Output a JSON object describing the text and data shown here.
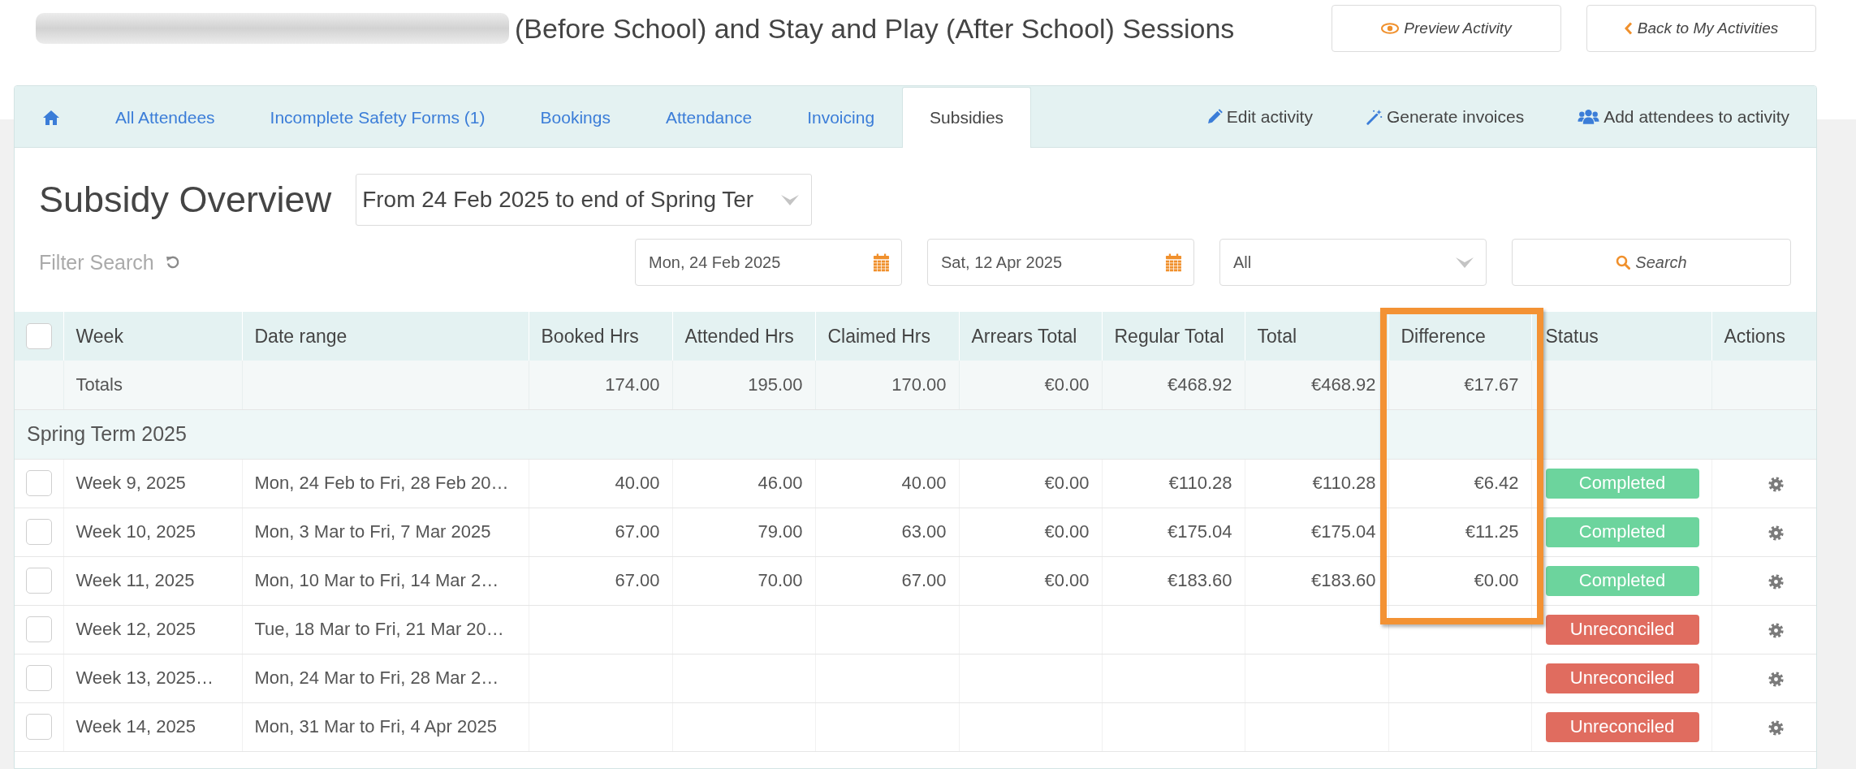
{
  "header": {
    "title_redacted": true,
    "title": "(Before School) and Stay and Play (After School) Sessions",
    "buttons": [
      {
        "kind": "preview",
        "label": "Preview Activity"
      },
      {
        "kind": "back",
        "label": "Back to My Activities"
      }
    ]
  },
  "tabs": [
    {
      "kind": "home",
      "selected": false
    },
    {
      "kind": "text",
      "label": "All Attendees",
      "selected": false
    },
    {
      "kind": "text",
      "label": "Incomplete Safety Forms (1)",
      "selected": false
    },
    {
      "kind": "text",
      "label": "Bookings",
      "selected": false
    },
    {
      "kind": "text",
      "label": "Attendance",
      "selected": false
    },
    {
      "kind": "text",
      "label": "Invoicing",
      "selected": false
    },
    {
      "kind": "text",
      "label": "Subsidies",
      "selected": true
    }
  ],
  "tab_actions": [
    {
      "kind": "edit",
      "label": "Edit activity"
    },
    {
      "kind": "generate",
      "label": "Generate invoices"
    },
    {
      "kind": "add-attendees",
      "label": "Add attendees to activity"
    }
  ],
  "overview": {
    "heading": "Subsidy Overview",
    "period": "From 24 Feb 2025 to end of Spring Ter",
    "filter_label": "Filter Search",
    "start_date": "Mon, 24 Feb 2025",
    "end_date": "Sat, 12 Apr 2025",
    "status_filter": "All",
    "search_button": "Search"
  },
  "table": {
    "select_all": {
      "checked": false
    },
    "columns": [
      "Week",
      "Date range",
      "Booked Hrs",
      "Attended Hrs",
      "Claimed Hrs",
      "Arrears Total",
      "Regular Total",
      "Total",
      "Difference",
      "Status",
      "Actions"
    ],
    "highlight_frame": true,
    "totals": {
      "label": "Totals",
      "booked": "174.00",
      "attended": "195.00",
      "claimed": "170.00",
      "arrears": "€0.00",
      "regular": "€468.92",
      "total": "€468.92",
      "difference": "€17.67"
    },
    "groups": [
      {
        "title": "Spring Term 2025",
        "rows": [
          {
            "checked": false,
            "week": "Week 9, 2025",
            "date_range": "Mon, 24 Feb to Fri, 28 Feb 20…",
            "booked": "40.00",
            "attended": "46.00",
            "claimed": "40.00",
            "arrears": "€0.00",
            "regular": "€110.28",
            "total": "€110.28",
            "difference": "€6.42",
            "status": {
              "label": "Completed",
              "color": "#6cd49d"
            }
          },
          {
            "checked": false,
            "week": "Week 10, 2025",
            "date_range": "Mon, 3 Mar to Fri, 7 Mar 2025",
            "booked": "67.00",
            "attended": "79.00",
            "claimed": "63.00",
            "arrears": "€0.00",
            "regular": "€175.04",
            "total": "€175.04",
            "difference": "€11.25",
            "status": {
              "label": "Completed",
              "color": "#6cd49d"
            }
          },
          {
            "checked": false,
            "week": "Week 11, 2025",
            "date_range": "Mon, 10 Mar to Fri, 14 Mar 2…",
            "booked": "67.00",
            "attended": "70.00",
            "claimed": "67.00",
            "arrears": "€0.00",
            "regular": "€183.60",
            "total": "€183.60",
            "difference": "€0.00",
            "status": {
              "label": "Completed",
              "color": "#6cd49d"
            }
          },
          {
            "checked": false,
            "week": "Week 12, 2025",
            "date_range": "Tue, 18 Mar to Fri, 21 Mar 20…",
            "status": {
              "label": "Unreconciled",
              "color": "#e06c5f"
            }
          },
          {
            "checked": false,
            "week": "Week 13, 2025…",
            "date_range": "Mon, 24 Mar to Fri, 28 Mar 2…",
            "status": {
              "label": "Unreconciled",
              "color": "#e06c5f"
            }
          },
          {
            "checked": false,
            "week": "Week 14, 2025",
            "date_range": "Mon, 31 Mar to Fri, 4 Apr 2025",
            "status": {
              "label": "Unreconciled",
              "color": "#e06c5f"
            }
          }
        ]
      }
    ]
  }
}
